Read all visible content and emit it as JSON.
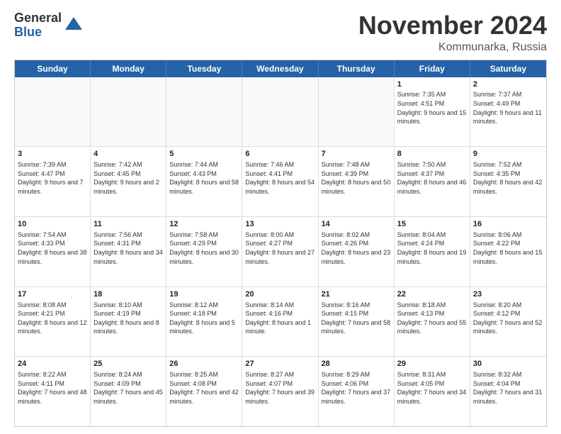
{
  "header": {
    "logo_line1": "General",
    "logo_line2": "Blue",
    "title": "November 2024",
    "location": "Kommunarka, Russia"
  },
  "calendar": {
    "days_of_week": [
      "Sunday",
      "Monday",
      "Tuesday",
      "Wednesday",
      "Thursday",
      "Friday",
      "Saturday"
    ],
    "rows": [
      [
        {
          "day": "",
          "info": "",
          "empty": true
        },
        {
          "day": "",
          "info": "",
          "empty": true
        },
        {
          "day": "",
          "info": "",
          "empty": true
        },
        {
          "day": "",
          "info": "",
          "empty": true
        },
        {
          "day": "",
          "info": "",
          "empty": true
        },
        {
          "day": "1",
          "info": "Sunrise: 7:35 AM\nSunset: 4:51 PM\nDaylight: 9 hours and 15 minutes."
        },
        {
          "day": "2",
          "info": "Sunrise: 7:37 AM\nSunset: 4:49 PM\nDaylight: 9 hours and 11 minutes."
        }
      ],
      [
        {
          "day": "3",
          "info": "Sunrise: 7:39 AM\nSunset: 4:47 PM\nDaylight: 9 hours and 7 minutes."
        },
        {
          "day": "4",
          "info": "Sunrise: 7:42 AM\nSunset: 4:45 PM\nDaylight: 9 hours and 2 minutes."
        },
        {
          "day": "5",
          "info": "Sunrise: 7:44 AM\nSunset: 4:43 PM\nDaylight: 8 hours and 58 minutes."
        },
        {
          "day": "6",
          "info": "Sunrise: 7:46 AM\nSunset: 4:41 PM\nDaylight: 8 hours and 54 minutes."
        },
        {
          "day": "7",
          "info": "Sunrise: 7:48 AM\nSunset: 4:39 PM\nDaylight: 8 hours and 50 minutes."
        },
        {
          "day": "8",
          "info": "Sunrise: 7:50 AM\nSunset: 4:37 PM\nDaylight: 8 hours and 46 minutes."
        },
        {
          "day": "9",
          "info": "Sunrise: 7:52 AM\nSunset: 4:35 PM\nDaylight: 8 hours and 42 minutes."
        }
      ],
      [
        {
          "day": "10",
          "info": "Sunrise: 7:54 AM\nSunset: 4:33 PM\nDaylight: 8 hours and 38 minutes."
        },
        {
          "day": "11",
          "info": "Sunrise: 7:56 AM\nSunset: 4:31 PM\nDaylight: 8 hours and 34 minutes."
        },
        {
          "day": "12",
          "info": "Sunrise: 7:58 AM\nSunset: 4:29 PM\nDaylight: 8 hours and 30 minutes."
        },
        {
          "day": "13",
          "info": "Sunrise: 8:00 AM\nSunset: 4:27 PM\nDaylight: 8 hours and 27 minutes."
        },
        {
          "day": "14",
          "info": "Sunrise: 8:02 AM\nSunset: 4:26 PM\nDaylight: 8 hours and 23 minutes."
        },
        {
          "day": "15",
          "info": "Sunrise: 8:04 AM\nSunset: 4:24 PM\nDaylight: 8 hours and 19 minutes."
        },
        {
          "day": "16",
          "info": "Sunrise: 8:06 AM\nSunset: 4:22 PM\nDaylight: 8 hours and 15 minutes."
        }
      ],
      [
        {
          "day": "17",
          "info": "Sunrise: 8:08 AM\nSunset: 4:21 PM\nDaylight: 8 hours and 12 minutes."
        },
        {
          "day": "18",
          "info": "Sunrise: 8:10 AM\nSunset: 4:19 PM\nDaylight: 8 hours and 8 minutes."
        },
        {
          "day": "19",
          "info": "Sunrise: 8:12 AM\nSunset: 4:18 PM\nDaylight: 8 hours and 5 minutes."
        },
        {
          "day": "20",
          "info": "Sunrise: 8:14 AM\nSunset: 4:16 PM\nDaylight: 8 hours and 1 minute."
        },
        {
          "day": "21",
          "info": "Sunrise: 8:16 AM\nSunset: 4:15 PM\nDaylight: 7 hours and 58 minutes."
        },
        {
          "day": "22",
          "info": "Sunrise: 8:18 AM\nSunset: 4:13 PM\nDaylight: 7 hours and 55 minutes."
        },
        {
          "day": "23",
          "info": "Sunrise: 8:20 AM\nSunset: 4:12 PM\nDaylight: 7 hours and 52 minutes."
        }
      ],
      [
        {
          "day": "24",
          "info": "Sunrise: 8:22 AM\nSunset: 4:11 PM\nDaylight: 7 hours and 48 minutes."
        },
        {
          "day": "25",
          "info": "Sunrise: 8:24 AM\nSunset: 4:09 PM\nDaylight: 7 hours and 45 minutes."
        },
        {
          "day": "26",
          "info": "Sunrise: 8:25 AM\nSunset: 4:08 PM\nDaylight: 7 hours and 42 minutes."
        },
        {
          "day": "27",
          "info": "Sunrise: 8:27 AM\nSunset: 4:07 PM\nDaylight: 7 hours and 39 minutes."
        },
        {
          "day": "28",
          "info": "Sunrise: 8:29 AM\nSunset: 4:06 PM\nDaylight: 7 hours and 37 minutes."
        },
        {
          "day": "29",
          "info": "Sunrise: 8:31 AM\nSunset: 4:05 PM\nDaylight: 7 hours and 34 minutes."
        },
        {
          "day": "30",
          "info": "Sunrise: 8:32 AM\nSunset: 4:04 PM\nDaylight: 7 hours and 31 minutes."
        }
      ]
    ]
  }
}
